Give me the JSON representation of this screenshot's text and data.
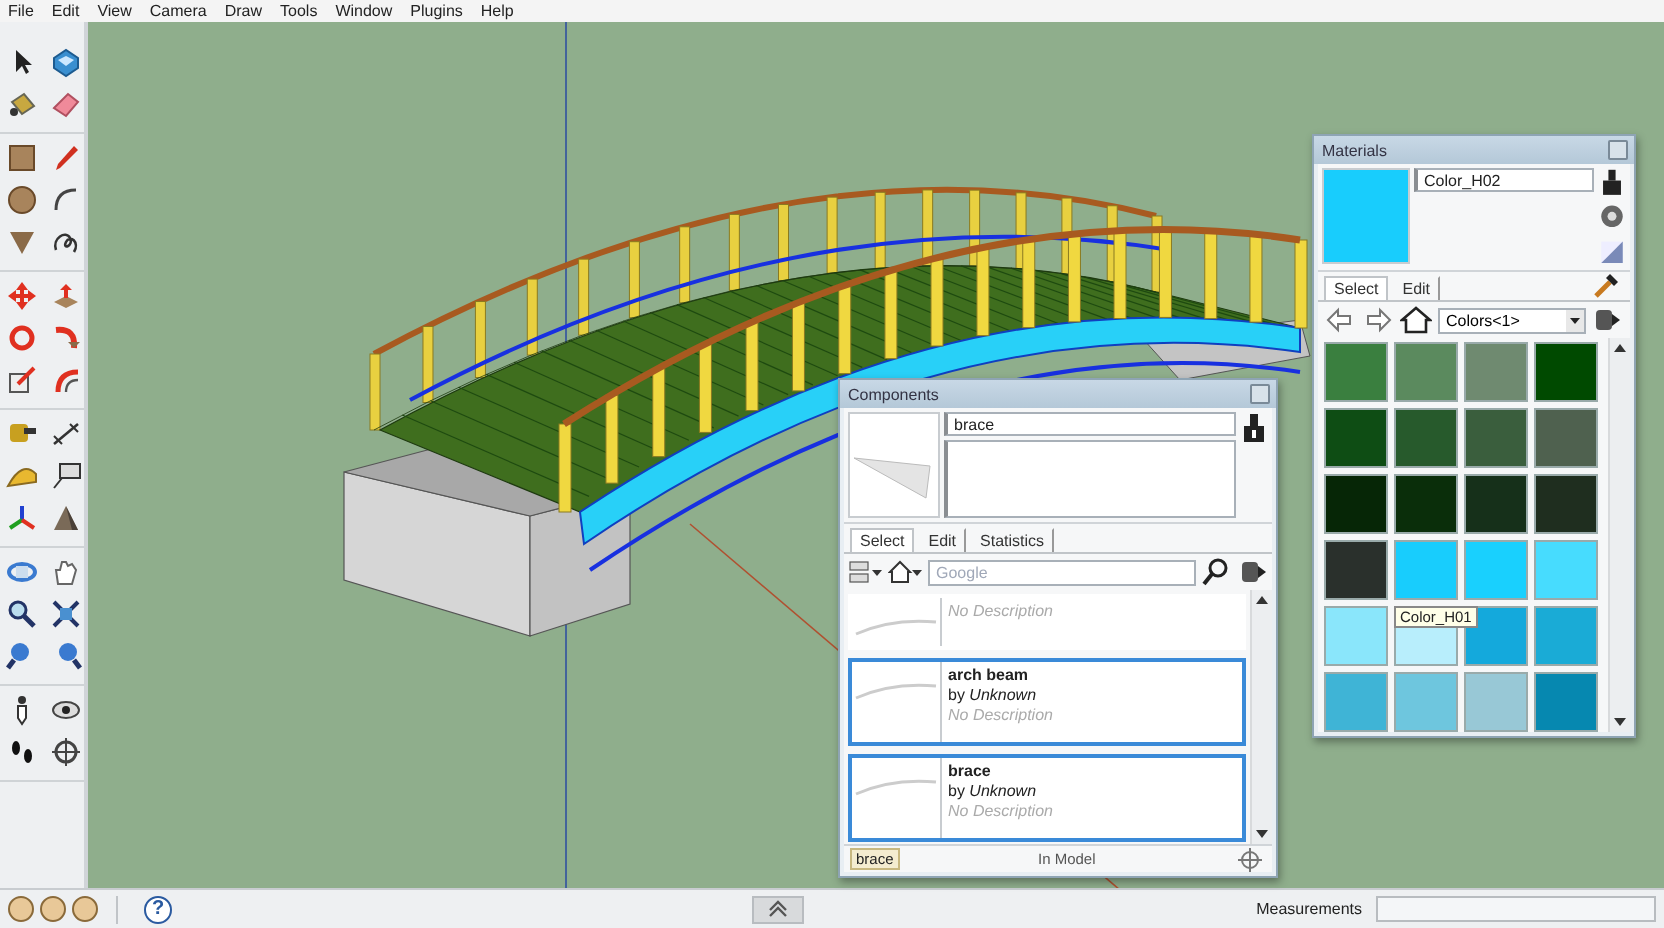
{
  "menu": [
    "File",
    "Edit",
    "View",
    "Camera",
    "Draw",
    "Tools",
    "Window",
    "Plugins",
    "Help"
  ],
  "components": {
    "title": "Components",
    "name": "brace",
    "tabs": [
      {
        "label": "Select",
        "selected": true
      },
      {
        "label": "Edit",
        "selected": false
      },
      {
        "label": "Statistics",
        "selected": false
      }
    ],
    "search": {
      "placeholder": "Google"
    },
    "items": [
      {
        "description": "No Description",
        "selected": false
      },
      {
        "name": "arch beam",
        "author": "by *Unknown*",
        "description": "No Description",
        "selected": true
      },
      {
        "name": "brace",
        "author": "by *Unknown*",
        "description": "No Description",
        "selected": true
      }
    ],
    "footer": {
      "filter": "brace",
      "label": "In Model"
    }
  },
  "materials": {
    "title": "Materials",
    "name": "Color_H02",
    "tabs": [
      {
        "label": "Select",
        "selected": true
      },
      {
        "label": "Edit",
        "selected": false
      }
    ],
    "collection": "Colors<1>",
    "swatches": [
      {
        "color": "#3a7f3f"
      },
      {
        "color": "#5b8a5e"
      },
      {
        "color": "#6f8a70"
      },
      {
        "color": "#004a00"
      },
      {
        "color": "#0e4d14"
      },
      {
        "color": "#275a2c"
      },
      {
        "color": "#3a5e3d"
      },
      {
        "color": "#4f614f"
      },
      {
        "color": "#062606"
      },
      {
        "color": "#0a2e0a"
      },
      {
        "color": "#16301a"
      },
      {
        "color": "#1f2e1f"
      },
      {
        "color": "#2a302c"
      },
      {
        "color": "#18cdfd"
      },
      {
        "color": "#19d0fe"
      },
      {
        "color": "#47dcfe"
      },
      {
        "color": "#8ae6fb"
      },
      {
        "color": "#b8eefc"
      },
      {
        "color": "#14a9dc"
      },
      {
        "color": "#1aabd6"
      },
      {
        "color": "#3fb4d6"
      },
      {
        "color": "#6ec6de"
      },
      {
        "color": "#98c8d6"
      },
      {
        "color": "#0688b0"
      }
    ],
    "tooltip": "Color_H01"
  },
  "status_bar": {
    "help": "?",
    "measurements_label": "Measurements"
  }
}
